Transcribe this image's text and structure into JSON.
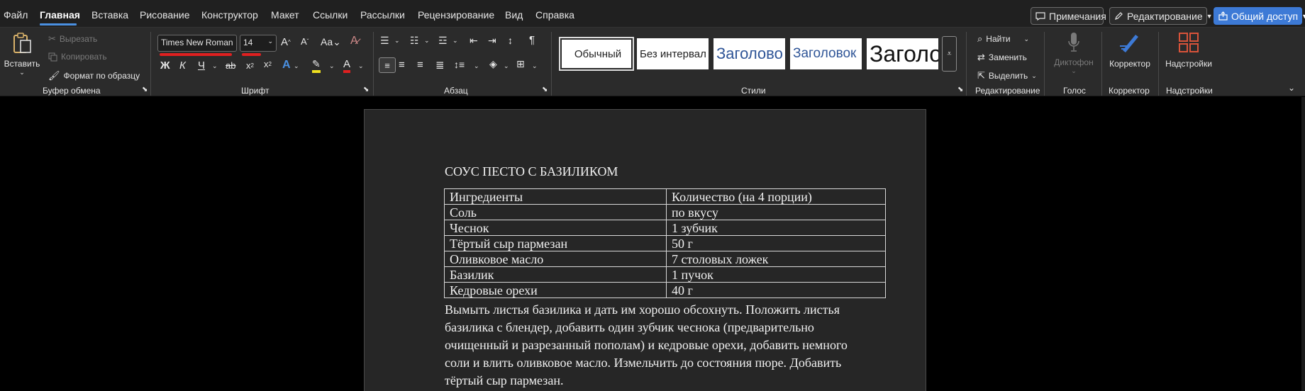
{
  "menu": {
    "file": "Файл",
    "home": "Главная",
    "insert": "Вставка",
    "draw": "Рисование",
    "design": "Конструктор",
    "layout": "Макет",
    "references": "Ссылки",
    "mailings": "Рассылки",
    "review": "Рецензирование",
    "view": "Вид",
    "help": "Справка"
  },
  "topbar": {
    "comments": "Примечания",
    "editing": "Редактирование",
    "share": "Общий доступ"
  },
  "clipboard": {
    "paste": "Вставить",
    "cut": "Вырезать",
    "copy": "Копировать",
    "format_painter": "Формат по образцу",
    "label": "Буфер обмена"
  },
  "font": {
    "name": "Times New Roman",
    "size": "14",
    "bold": "Ж",
    "italic": "К",
    "underline": "Ч",
    "strike": "ab",
    "label": "Шрифт"
  },
  "paragraph": {
    "label": "Абзац"
  },
  "styles": {
    "items": [
      "Обычный",
      "Без интервал",
      "Заголово",
      "Заголовок",
      "Заголо"
    ],
    "label": "Стили"
  },
  "editing": {
    "find": "Найти",
    "replace": "Заменить",
    "select": "Выделить",
    "label": "Редактирование"
  },
  "voice": {
    "dictate": "Диктофон",
    "label": "Голос"
  },
  "editor": {
    "name": "Корректор",
    "label": "Корректор"
  },
  "addins": {
    "name": "Надстройки",
    "label": "Надстройки"
  },
  "document": {
    "title": "СОУС ПЕСТО С БАЗИЛИКОМ",
    "table": [
      [
        "Ингредиенты",
        "Количество (на 4 порции)"
      ],
      [
        "Соль",
        "по вкусу"
      ],
      [
        "Чеснок",
        "1 зубчик"
      ],
      [
        "Тёртый сыр пармезан",
        "50 г"
      ],
      [
        "Оливковое масло",
        "7 столовых ложек"
      ],
      [
        "Базилик",
        "1 пучок"
      ],
      [
        "Кедровые орехи",
        "40 г"
      ]
    ],
    "paragraph_lines": [
      "Вымыть листья базилика и дать им хорошо обсохнуть. Положить листья",
      "базилика с блендер, добавить один зубчик чеснока (предварительно",
      "очищенный и разрезанный пополам) и кедровые орехи, добавить немного",
      "соли и влить оливковое масло. Измельчить до состояния пюре. Добавить",
      "тёртый сыр пармезан."
    ]
  },
  "colors": {
    "accent": "#4a90e2",
    "share": "#3d7ad6",
    "ribbon": "#2b2b2b",
    "page": "#262626"
  }
}
